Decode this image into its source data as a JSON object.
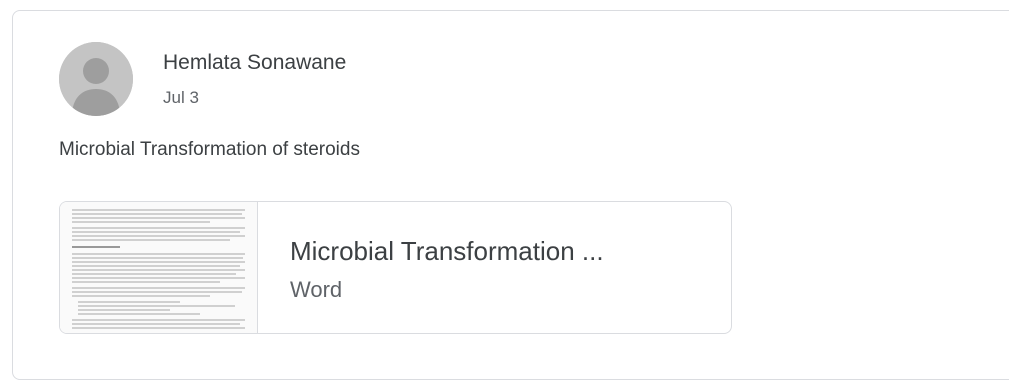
{
  "post": {
    "author": "Hemlata Sonawane",
    "date": "Jul 3",
    "text": "Microbial Transformation of steroids"
  },
  "attachment": {
    "title": "Microbial Transformation ...",
    "type": "Word"
  },
  "icons": {
    "avatar": "default-user-avatar-icon",
    "thumbnail": "document-preview-thumbnail"
  },
  "colors": {
    "border": "#dadce0",
    "primary_text": "#3c4043",
    "secondary_text": "#5f6368",
    "avatar_bg": "#c4c4c4"
  }
}
